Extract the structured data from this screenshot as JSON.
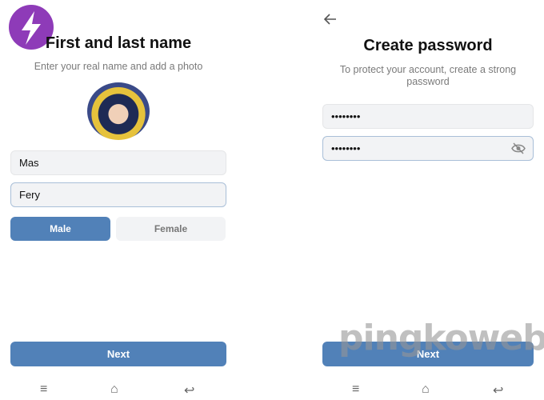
{
  "left": {
    "title": "First and last name",
    "subtitle": "Enter your real name and add a photo",
    "first_name": "Mas",
    "last_name": "Fery",
    "gender": {
      "male": "Male",
      "female": "Female",
      "selected": "Male"
    },
    "next": "Next"
  },
  "right": {
    "back_icon": "arrow-left-icon",
    "title": "Create password",
    "subtitle": "To protect your account, create a strong password",
    "password": "••••••••",
    "confirm": "••••••••",
    "toggle_icon": "eye-off-icon",
    "next": "Next"
  },
  "nav": {
    "menu": "≡",
    "home": "⌂",
    "back": "↩"
  },
  "watermark": "pingkoweb",
  "colors": {
    "accent": "#5181b8",
    "logo": "#8e3bb8"
  }
}
